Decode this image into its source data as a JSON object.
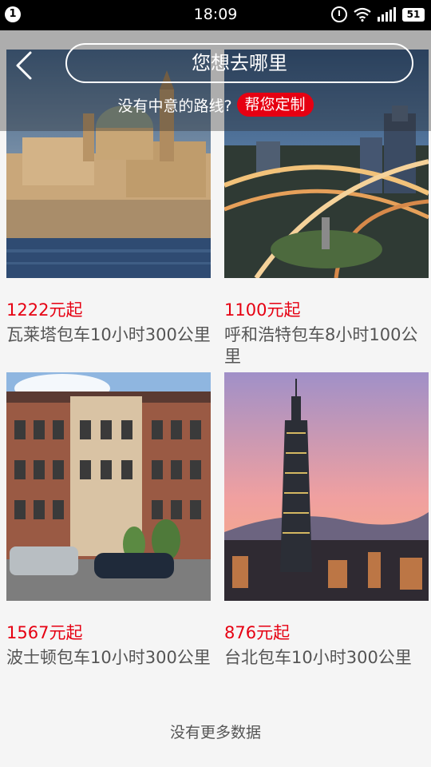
{
  "status_bar": {
    "notification_count": "1",
    "time": "18:09",
    "battery": "51"
  },
  "header": {
    "title": "您想去哪里",
    "subtitle": "没有中意的路线?",
    "custom_button": "帮您定制"
  },
  "routes": [
    {
      "price": "1222元起",
      "name": "瓦莱塔包车10小时300公里"
    },
    {
      "price": "1100元起",
      "name": "呼和浩特包车8小时100公里"
    },
    {
      "price": "1567元起",
      "name": "波士顿包车10小时300公里"
    },
    {
      "price": "876元起",
      "name": "台北包车10小时300公里"
    }
  ],
  "footer": {
    "no_more": "没有更多数据"
  },
  "colors": {
    "accent": "#e60012",
    "status_bar": "#000000",
    "background": "#f5f5f5"
  }
}
